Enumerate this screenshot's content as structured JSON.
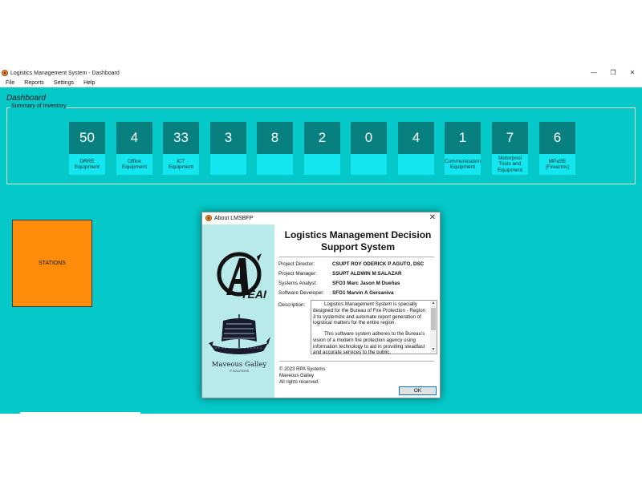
{
  "window": {
    "title": "Logistics Management System - Dashboard",
    "controls": {
      "minimize": "—",
      "maximize": "❐",
      "close": "✕"
    }
  },
  "menu": [
    "File",
    "Reports",
    "Settings",
    "Help"
  ],
  "dashboard": {
    "title": "Dashboard",
    "summary_label": "Summary of Inventory",
    "tiles": [
      {
        "value": "50",
        "label": "DRRE Equipment"
      },
      {
        "value": "4",
        "label": "Office Equipment"
      },
      {
        "value": "33",
        "label": "ICT Equipment"
      },
      {
        "value": "3",
        "label": ""
      },
      {
        "value": "8",
        "label": ""
      },
      {
        "value": "2",
        "label": ""
      },
      {
        "value": "0",
        "label": ""
      },
      {
        "value": "4",
        "label": ""
      },
      {
        "value": "1",
        "label": "Communication Equipment"
      },
      {
        "value": "7",
        "label": "Motorpool Tools and Equipment"
      },
      {
        "value": "6",
        "label": "MPaSE (Firearms)"
      }
    ],
    "stations_label": "STATIONS"
  },
  "about": {
    "title": "About LMSBFP",
    "close": "✕",
    "app_name_line1": "Logistics Management Decision",
    "app_name_line2": "Support System",
    "rows": [
      {
        "key": "Project Director:",
        "value": "CSUPT ROY ODERICK P AGUTO, DSC"
      },
      {
        "key": "Project Manager:",
        "value": "SSUPT ALDWIN M SALAZAR"
      },
      {
        "key": "Systems Analyst:",
        "value": "SFO3 Marc Jason M Dueñas"
      },
      {
        "key": "Software Developer:",
        "value": "SFO1 Marvin A Gersaniva"
      }
    ],
    "description_label": "Description:",
    "description_p1": "Logistics Management System is specially designed for the Bureau of Fire Protection - Region 3 to systemize and automate report generation of logistical matters for the entire region.",
    "description_p2": "This software system adheres to the Bureau's vision of a modern fire protection agency using information technology to aid in providing steadfast and accurate services to the public.",
    "copyright": "© 2023 RPA Systems",
    "company": "Maveous Galley",
    "rights": "All rights reserved.",
    "ok": "OK",
    "logo_text": "TEAM",
    "logo_letter": "A",
    "galley_name": "Maveous Galley",
    "galley_sub": "IT SOLUTIONS"
  }
}
